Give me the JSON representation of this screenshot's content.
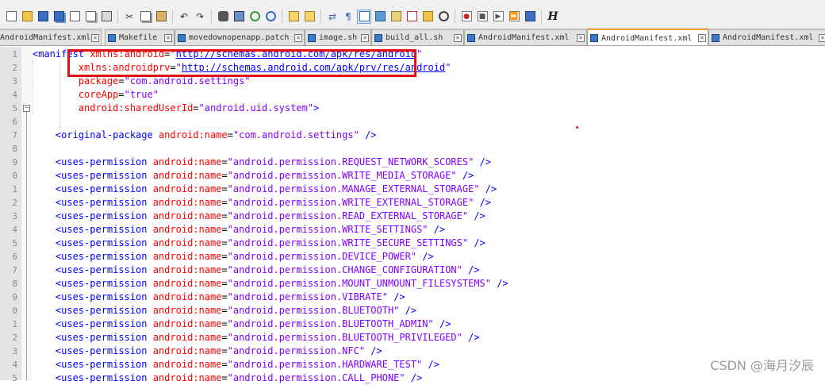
{
  "toolbar": {
    "icons": [
      "new-file-icon",
      "open-file-icon",
      "save-icon",
      "save-all-icon",
      "close-icon",
      "close-all-icon",
      "print-icon",
      "cut-icon",
      "copy-icon",
      "paste-icon",
      "undo-icon",
      "redo-icon",
      "find-icon",
      "replace-icon",
      "zoom-in-icon",
      "zoom-out-icon",
      "sync-vertical-icon",
      "sync-horizontal-icon",
      "word-wrap-icon",
      "show-all-chars-icon",
      "indent-guide-icon",
      "user-language-icon",
      "doc-map-icon",
      "function-list-icon",
      "folder-workspace-icon",
      "monitoring-icon",
      "record-macro-icon",
      "stop-macro-icon",
      "play-macro-icon",
      "run-macro-multiple-icon",
      "save-macro-icon",
      "hex-icon"
    ],
    "hex_label": "H"
  },
  "tabs": [
    {
      "label": "AndroidManifest.xml",
      "active": false,
      "icon_color": "#3c78c8"
    },
    {
      "label": "Makefile",
      "active": false,
      "icon_color": "#3c78c8"
    },
    {
      "label": "movedownopenapp.patch",
      "active": false,
      "icon_color": "#3c78c8"
    },
    {
      "label": "image.sh",
      "active": false,
      "icon_color": "#3c78c8"
    },
    {
      "label": "build_all.sh",
      "active": false,
      "icon_color": "#3c78c8"
    },
    {
      "label": "AndroidManifest.xml",
      "active": false,
      "icon_color": "#3c78c8"
    },
    {
      "label": "AndroidManifest.xml",
      "active": true,
      "icon_color": "#3c78c8"
    },
    {
      "label": "AndroidManifest.xml",
      "active": false,
      "icon_color": "#3c78c8"
    }
  ],
  "tab_close_glyph": "×",
  "lines": [
    {
      "n": "1",
      "parts": [
        [
          "tag",
          "<manifest "
        ],
        [
          "attr",
          "xmlns:android"
        ],
        [
          "plain",
          "="
        ],
        [
          "val",
          "\""
        ],
        [
          "url",
          "http://schemas.android.com/apk/res/android"
        ],
        [
          "val",
          "\""
        ]
      ]
    },
    {
      "n": "2",
      "parts": [
        [
          "plain",
          "        "
        ],
        [
          "attr",
          "xmlns:androidprv"
        ],
        [
          "plain",
          "="
        ],
        [
          "val",
          "\""
        ],
        [
          "url",
          "http://schemas.android.com/apk/prv/res/android"
        ],
        [
          "val",
          "\""
        ]
      ]
    },
    {
      "n": "3",
      "parts": [
        [
          "plain",
          "        "
        ],
        [
          "attr",
          "package"
        ],
        [
          "plain",
          "="
        ],
        [
          "val",
          "\"com.android.settings\""
        ]
      ]
    },
    {
      "n": "4",
      "parts": [
        [
          "plain",
          "        "
        ],
        [
          "attr",
          "coreApp"
        ],
        [
          "plain",
          "="
        ],
        [
          "val",
          "\"true\""
        ]
      ]
    },
    {
      "n": "5",
      "parts": [
        [
          "plain",
          "        "
        ],
        [
          "attr",
          "android:sharedUserId"
        ],
        [
          "plain",
          "="
        ],
        [
          "val",
          "\"android.uid.system\""
        ],
        [
          "tag",
          ">"
        ]
      ]
    },
    {
      "n": "6",
      "parts": []
    },
    {
      "n": "7",
      "parts": [
        [
          "plain",
          "    "
        ],
        [
          "tag",
          "<original-package "
        ],
        [
          "attr",
          "android:name"
        ],
        [
          "plain",
          "="
        ],
        [
          "val",
          "\"com.android.settings\""
        ],
        [
          "tag",
          " />"
        ]
      ]
    },
    {
      "n": "8",
      "parts": []
    },
    {
      "n": "9",
      "parts": [
        [
          "plain",
          "    "
        ],
        [
          "tag",
          "<uses-permission "
        ],
        [
          "attr",
          "android:name"
        ],
        [
          "plain",
          "="
        ],
        [
          "val",
          "\"android.permission.REQUEST_NETWORK_SCORES\""
        ],
        [
          "tag",
          " />"
        ]
      ]
    },
    {
      "n": "0",
      "parts": [
        [
          "plain",
          "    "
        ],
        [
          "tag",
          "<uses-permission "
        ],
        [
          "attr",
          "android:name"
        ],
        [
          "plain",
          "="
        ],
        [
          "val",
          "\"android.permission.WRITE_MEDIA_STORAGE\""
        ],
        [
          "tag",
          " />"
        ]
      ]
    },
    {
      "n": "1",
      "parts": [
        [
          "plain",
          "    "
        ],
        [
          "tag",
          "<uses-permission "
        ],
        [
          "attr",
          "android:name"
        ],
        [
          "plain",
          "="
        ],
        [
          "val",
          "\"android.permission.MANAGE_EXTERNAL_STORAGE\""
        ],
        [
          "tag",
          " />"
        ]
      ]
    },
    {
      "n": "2",
      "parts": [
        [
          "plain",
          "    "
        ],
        [
          "tag",
          "<uses-permission "
        ],
        [
          "attr",
          "android:name"
        ],
        [
          "plain",
          "="
        ],
        [
          "val",
          "\"android.permission.WRITE_EXTERNAL_STORAGE\""
        ],
        [
          "tag",
          " />"
        ]
      ]
    },
    {
      "n": "3",
      "parts": [
        [
          "plain",
          "    "
        ],
        [
          "tag",
          "<uses-permission "
        ],
        [
          "attr",
          "android:name"
        ],
        [
          "plain",
          "="
        ],
        [
          "val",
          "\"android.permission.READ_EXTERNAL_STORAGE\""
        ],
        [
          "tag",
          " />"
        ]
      ]
    },
    {
      "n": "4",
      "parts": [
        [
          "plain",
          "    "
        ],
        [
          "tag",
          "<uses-permission "
        ],
        [
          "attr",
          "android:name"
        ],
        [
          "plain",
          "="
        ],
        [
          "val",
          "\"android.permission.WRITE_SETTINGS\""
        ],
        [
          "tag",
          " />"
        ]
      ]
    },
    {
      "n": "5",
      "parts": [
        [
          "plain",
          "    "
        ],
        [
          "tag",
          "<uses-permission "
        ],
        [
          "attr",
          "android:name"
        ],
        [
          "plain",
          "="
        ],
        [
          "val",
          "\"android.permission.WRITE_SECURE_SETTINGS\""
        ],
        [
          "tag",
          " />"
        ]
      ]
    },
    {
      "n": "6",
      "parts": [
        [
          "plain",
          "    "
        ],
        [
          "tag",
          "<uses-permission "
        ],
        [
          "attr",
          "android:name"
        ],
        [
          "plain",
          "="
        ],
        [
          "val",
          "\"android.permission.DEVICE_POWER\""
        ],
        [
          "tag",
          " />"
        ]
      ]
    },
    {
      "n": "7",
      "parts": [
        [
          "plain",
          "    "
        ],
        [
          "tag",
          "<uses-permission "
        ],
        [
          "attr",
          "android:name"
        ],
        [
          "plain",
          "="
        ],
        [
          "val",
          "\"android.permission.CHANGE_CONFIGURATION\""
        ],
        [
          "tag",
          " />"
        ]
      ]
    },
    {
      "n": "8",
      "parts": [
        [
          "plain",
          "    "
        ],
        [
          "tag",
          "<uses-permission "
        ],
        [
          "attr",
          "android:name"
        ],
        [
          "plain",
          "="
        ],
        [
          "val",
          "\"android.permission.MOUNT_UNMOUNT_FILESYSTEMS\""
        ],
        [
          "tag",
          " />"
        ]
      ]
    },
    {
      "n": "9",
      "parts": [
        [
          "plain",
          "    "
        ],
        [
          "tag",
          "<uses-permission "
        ],
        [
          "attr",
          "android:name"
        ],
        [
          "plain",
          "="
        ],
        [
          "val",
          "\"android.permission.VIBRATE\""
        ],
        [
          "tag",
          " />"
        ]
      ]
    },
    {
      "n": "0",
      "parts": [
        [
          "plain",
          "    "
        ],
        [
          "tag",
          "<uses-permission "
        ],
        [
          "attr",
          "android:name"
        ],
        [
          "plain",
          "="
        ],
        [
          "val",
          "\"android.permission.BLUETOOTH\""
        ],
        [
          "tag",
          " />"
        ]
      ]
    },
    {
      "n": "1",
      "parts": [
        [
          "plain",
          "    "
        ],
        [
          "tag",
          "<uses-permission "
        ],
        [
          "attr",
          "android:name"
        ],
        [
          "plain",
          "="
        ],
        [
          "val",
          "\"android.permission.BLUETOOTH_ADMIN\""
        ],
        [
          "tag",
          " />"
        ]
      ]
    },
    {
      "n": "2",
      "parts": [
        [
          "plain",
          "    "
        ],
        [
          "tag",
          "<uses-permission "
        ],
        [
          "attr",
          "android:name"
        ],
        [
          "plain",
          "="
        ],
        [
          "val",
          "\"android.permission.BLUETOOTH_PRIVILEGED\""
        ],
        [
          "tag",
          " />"
        ]
      ]
    },
    {
      "n": "3",
      "parts": [
        [
          "plain",
          "    "
        ],
        [
          "tag",
          "<uses-permission "
        ],
        [
          "attr",
          "android:name"
        ],
        [
          "plain",
          "="
        ],
        [
          "val",
          "\"android.permission.NFC\""
        ],
        [
          "tag",
          " />"
        ]
      ]
    },
    {
      "n": "4",
      "parts": [
        [
          "plain",
          "    "
        ],
        [
          "tag",
          "<uses-permission "
        ],
        [
          "attr",
          "android:name"
        ],
        [
          "plain",
          "="
        ],
        [
          "val",
          "\"android.permission.HARDWARE_TEST\""
        ],
        [
          "tag",
          " />"
        ]
      ]
    },
    {
      "n": "5",
      "parts": [
        [
          "plain",
          "    "
        ],
        [
          "tag",
          "<uses-permission "
        ],
        [
          "attr",
          "android:name"
        ],
        [
          "plain",
          "="
        ],
        [
          "val",
          "\"android.permission.CALL_PHONE\""
        ],
        [
          "tag",
          " />"
        ]
      ]
    }
  ],
  "fold_glyph": "−",
  "watermark": "CSDN @海月汐辰",
  "colors": {
    "tag": "#0000ff",
    "attr": "#ff0000",
    "value": "#8000ff",
    "highlight": "#e01010",
    "active_tab_accent": "#f0a030"
  }
}
